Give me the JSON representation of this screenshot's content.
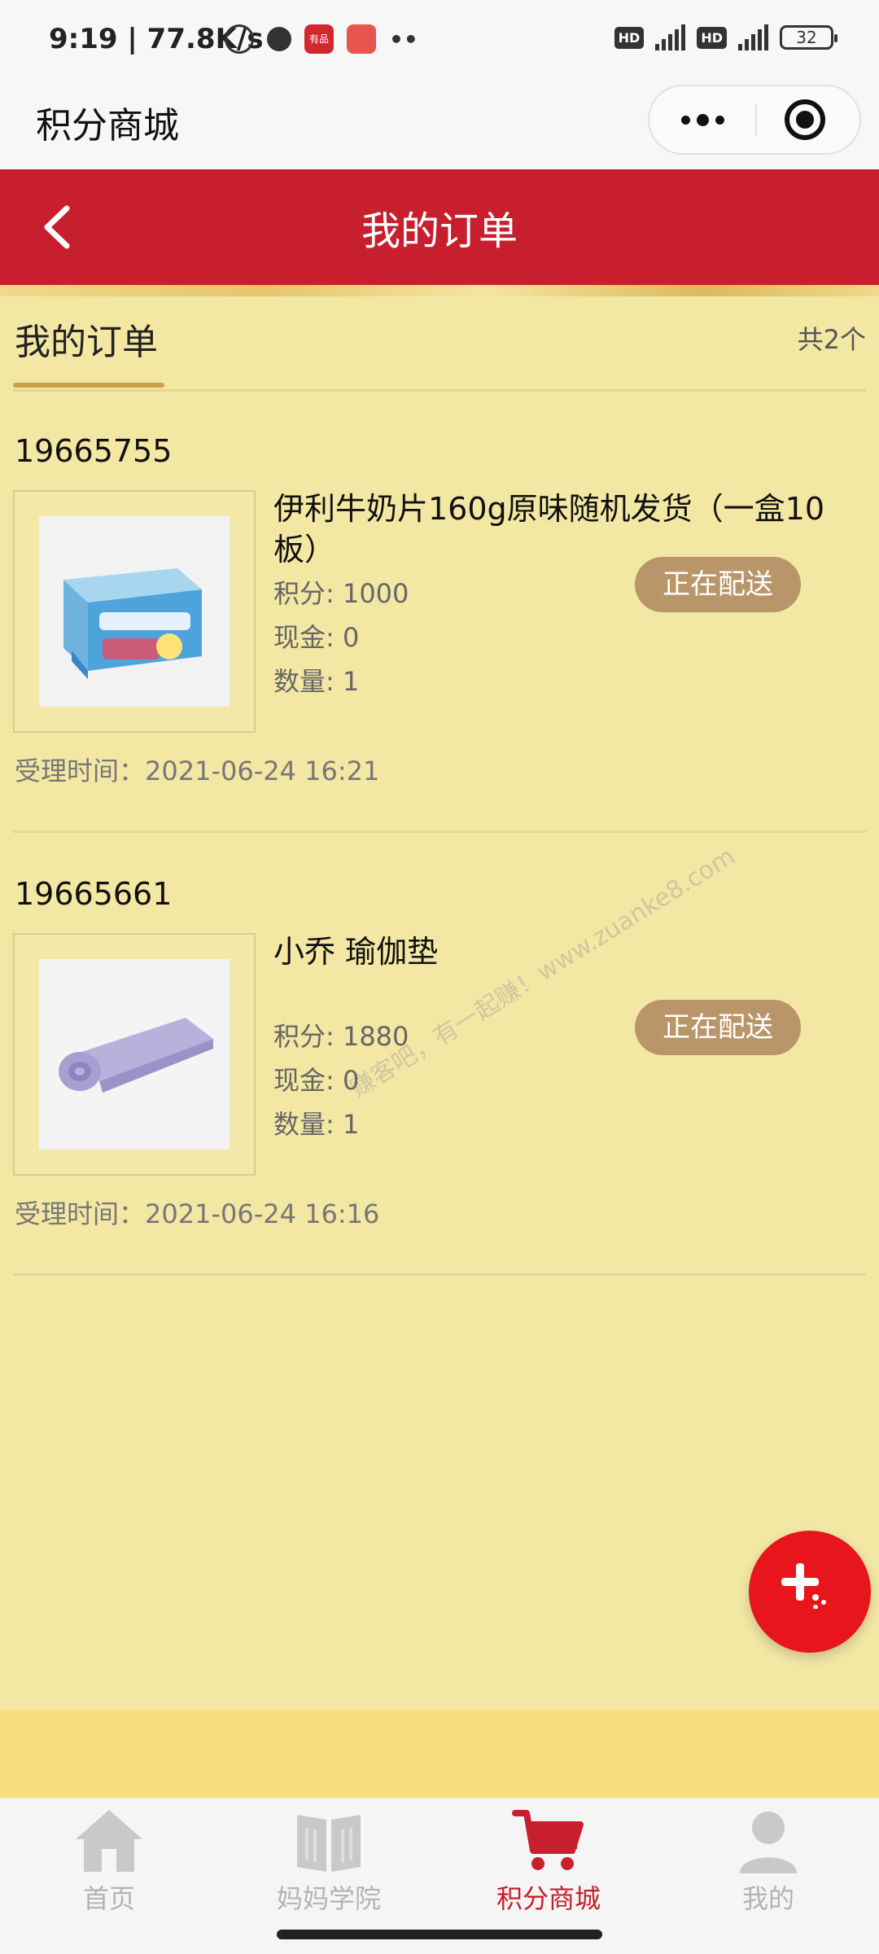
{
  "status_bar": {
    "time": "9:19",
    "speed": "| 77.8K/s",
    "red_app_label": "有品",
    "hd_1": "HD",
    "network_1": "4G",
    "hd_2": "HD",
    "network_2": "4G",
    "battery": "32"
  },
  "mini_program": {
    "title": "积分商城"
  },
  "header": {
    "title": "我的订单"
  },
  "section": {
    "title": "我的订单",
    "count": "共2个"
  },
  "orders": [
    {
      "id": "19665755",
      "product_name": "伊利牛奶片160g原味随机发货（一盒10板）",
      "points": "积分: 1000",
      "cash": "现金: 0",
      "quantity": "数量: 1",
      "status": "正在配送",
      "accepted_time": "受理时间：2021-06-24 16:21"
    },
    {
      "id": "19665661",
      "product_name": "小乔 瑜伽垫",
      "points": "积分: 1880",
      "cash": "现金: 0",
      "quantity": "数量: 1",
      "status": "正在配送",
      "accepted_time": "受理时间：2021-06-24 16:16"
    }
  ],
  "watermark": "赚客吧，有一起赚！www.zuanke8.com",
  "bottom_nav": [
    {
      "label": "首页",
      "icon": "home-icon",
      "active": false
    },
    {
      "label": "妈妈学院",
      "icon": "book-icon",
      "active": false
    },
    {
      "label": "积分商城",
      "icon": "cart-icon",
      "active": true
    },
    {
      "label": "我的",
      "icon": "user-icon",
      "active": false
    }
  ],
  "colors": {
    "header_red": "#c81f2e",
    "page_background": "#f3e7a4",
    "status_button": "#b9956a",
    "fab_red": "#e8161c",
    "active_nav": "#c81f2e"
  }
}
